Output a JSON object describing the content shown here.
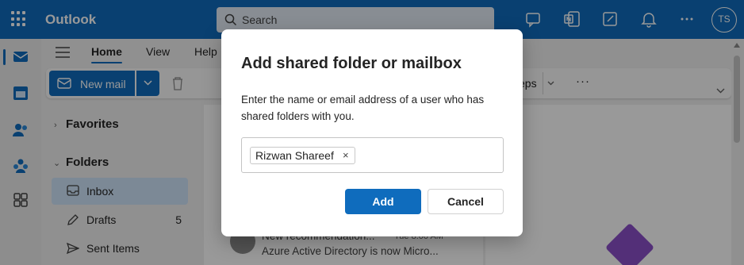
{
  "app": {
    "name": "Outlook",
    "accent": "#0f6cbd"
  },
  "header": {
    "search_placeholder": "Search",
    "avatar_initials": "TS",
    "icons": [
      "waffle-icon",
      "teams-chat-icon",
      "onenote-icon",
      "feedback-icon",
      "notifications-icon",
      "more-icon"
    ]
  },
  "rail": {
    "icons": [
      "mail-icon",
      "calendar-icon",
      "people-icon",
      "groups-icon",
      "apps-icon"
    ]
  },
  "ribbon": {
    "tabs": [
      "Home",
      "View",
      "Help"
    ],
    "new_mail_label": "New mail",
    "quick_steps_fragment": "eps",
    "more_label": "···"
  },
  "folder_pane": {
    "favorites_label": "Favorites",
    "folders_label": "Folders",
    "folders": [
      {
        "label": "Inbox",
        "count": "",
        "icon": "inbox-icon"
      },
      {
        "label": "Drafts",
        "count": "5",
        "icon": "drafts-icon"
      },
      {
        "label": "Sent Items",
        "count": "",
        "icon": "sent-icon"
      }
    ]
  },
  "message_list": {
    "item": {
      "subject": "New recommendation...",
      "time": "Tue 8:00 AM",
      "preview": "Azure Active Directory is now Micro..."
    }
  },
  "dialog": {
    "title": "Add shared folder or mailbox",
    "description": "Enter the name or email address of a user who has shared folders with you.",
    "recipient": "Rizwan Shareef",
    "remove_label": "×",
    "add_label": "Add",
    "cancel_label": "Cancel"
  }
}
